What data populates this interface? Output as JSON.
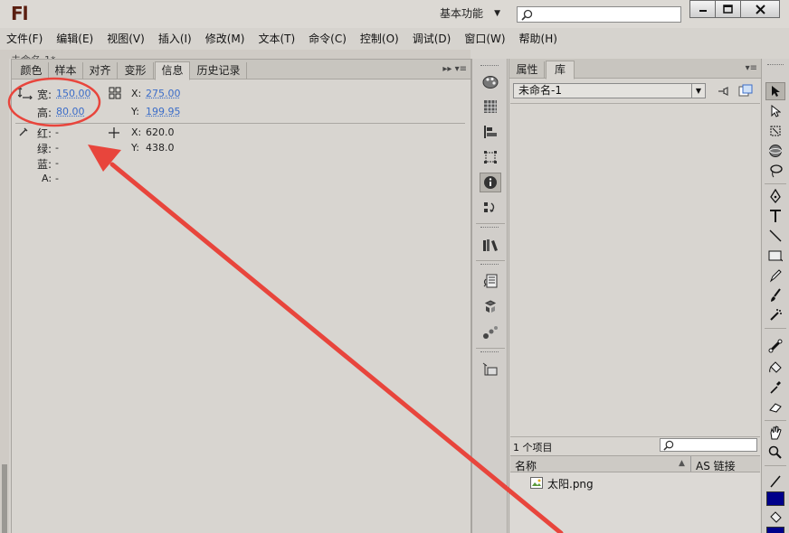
{
  "app": {
    "logo": "Fl",
    "workspace": "基本功能",
    "search_placeholder": ""
  },
  "menu": [
    "文件(F)",
    "编辑(E)",
    "视图(V)",
    "插入(I)",
    "修改(M)",
    "文本(T)",
    "命令(C)",
    "控制(O)",
    "调试(D)",
    "窗口(W)",
    "帮助(H)"
  ],
  "document_tab": "未命名-1*",
  "left_panel": {
    "tabs": [
      "颜色",
      "样本",
      "对齐",
      "变形",
      "信息",
      "历史记录"
    ],
    "active_tab": "信息",
    "info": {
      "width_label": "宽:",
      "width_value": "150.00",
      "height_label": "高:",
      "height_value": "80.00",
      "x_label": "X:",
      "x_value": "275.00",
      "y_label": "Y:",
      "y_value": "199.95",
      "red_label": "红:",
      "red_value": "-",
      "green_label": "绿:",
      "green_value": "-",
      "blue_label": "蓝:",
      "blue_value": "-",
      "alpha_label": "A:",
      "alpha_value": "-",
      "cursor_x_label": "X:",
      "cursor_x_value": "620.0",
      "cursor_y_label": "Y:",
      "cursor_y_value": "438.0"
    }
  },
  "right_panel": {
    "tabs": [
      "属性",
      "库"
    ],
    "active_tab": "库",
    "document_select": "未命名-1",
    "item_count": "1 个项目",
    "col_name": "名称",
    "col_linkage": "AS 链接",
    "items": [
      {
        "name": "太阳.png"
      }
    ]
  },
  "colors": {
    "annotation": "#e8453c",
    "fill_swatch": "#00008a",
    "value_link": "#3a6cc8"
  }
}
